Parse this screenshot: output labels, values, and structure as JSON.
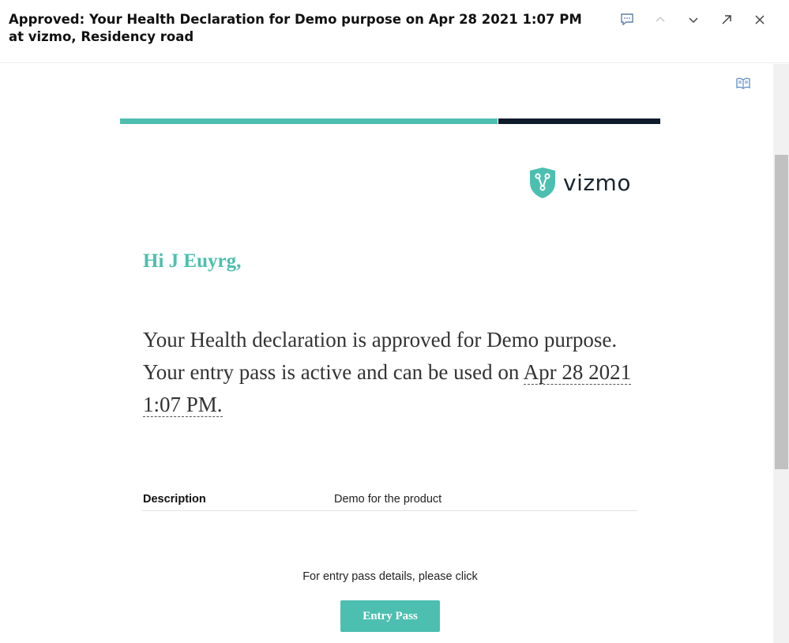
{
  "email": {
    "subject": "Approved: Your Health Declaration for Demo purpose on Apr 28 2021 1:07 PM at vizmo, Residency road"
  },
  "actions": [
    "reply-comment-icon",
    "chevron-up-icon",
    "chevron-down-icon",
    "expand-icon",
    "close-icon"
  ],
  "brand": {
    "name": "vizmo",
    "accent_color": "#4dbfb0",
    "dark_color": "#0d1b2a"
  },
  "body": {
    "greeting": "Hi J Euyrg,",
    "message_prefix": "Your Health declaration is approved for Demo purpose. Your entry pass is active and can be used on ",
    "message_datetime": "Apr 28 2021 1:07 PM.",
    "details": [
      {
        "label": "Description",
        "value": "Demo for the product"
      }
    ],
    "entry_text": "For entry pass details, please click",
    "entry_button": "Entry Pass"
  }
}
